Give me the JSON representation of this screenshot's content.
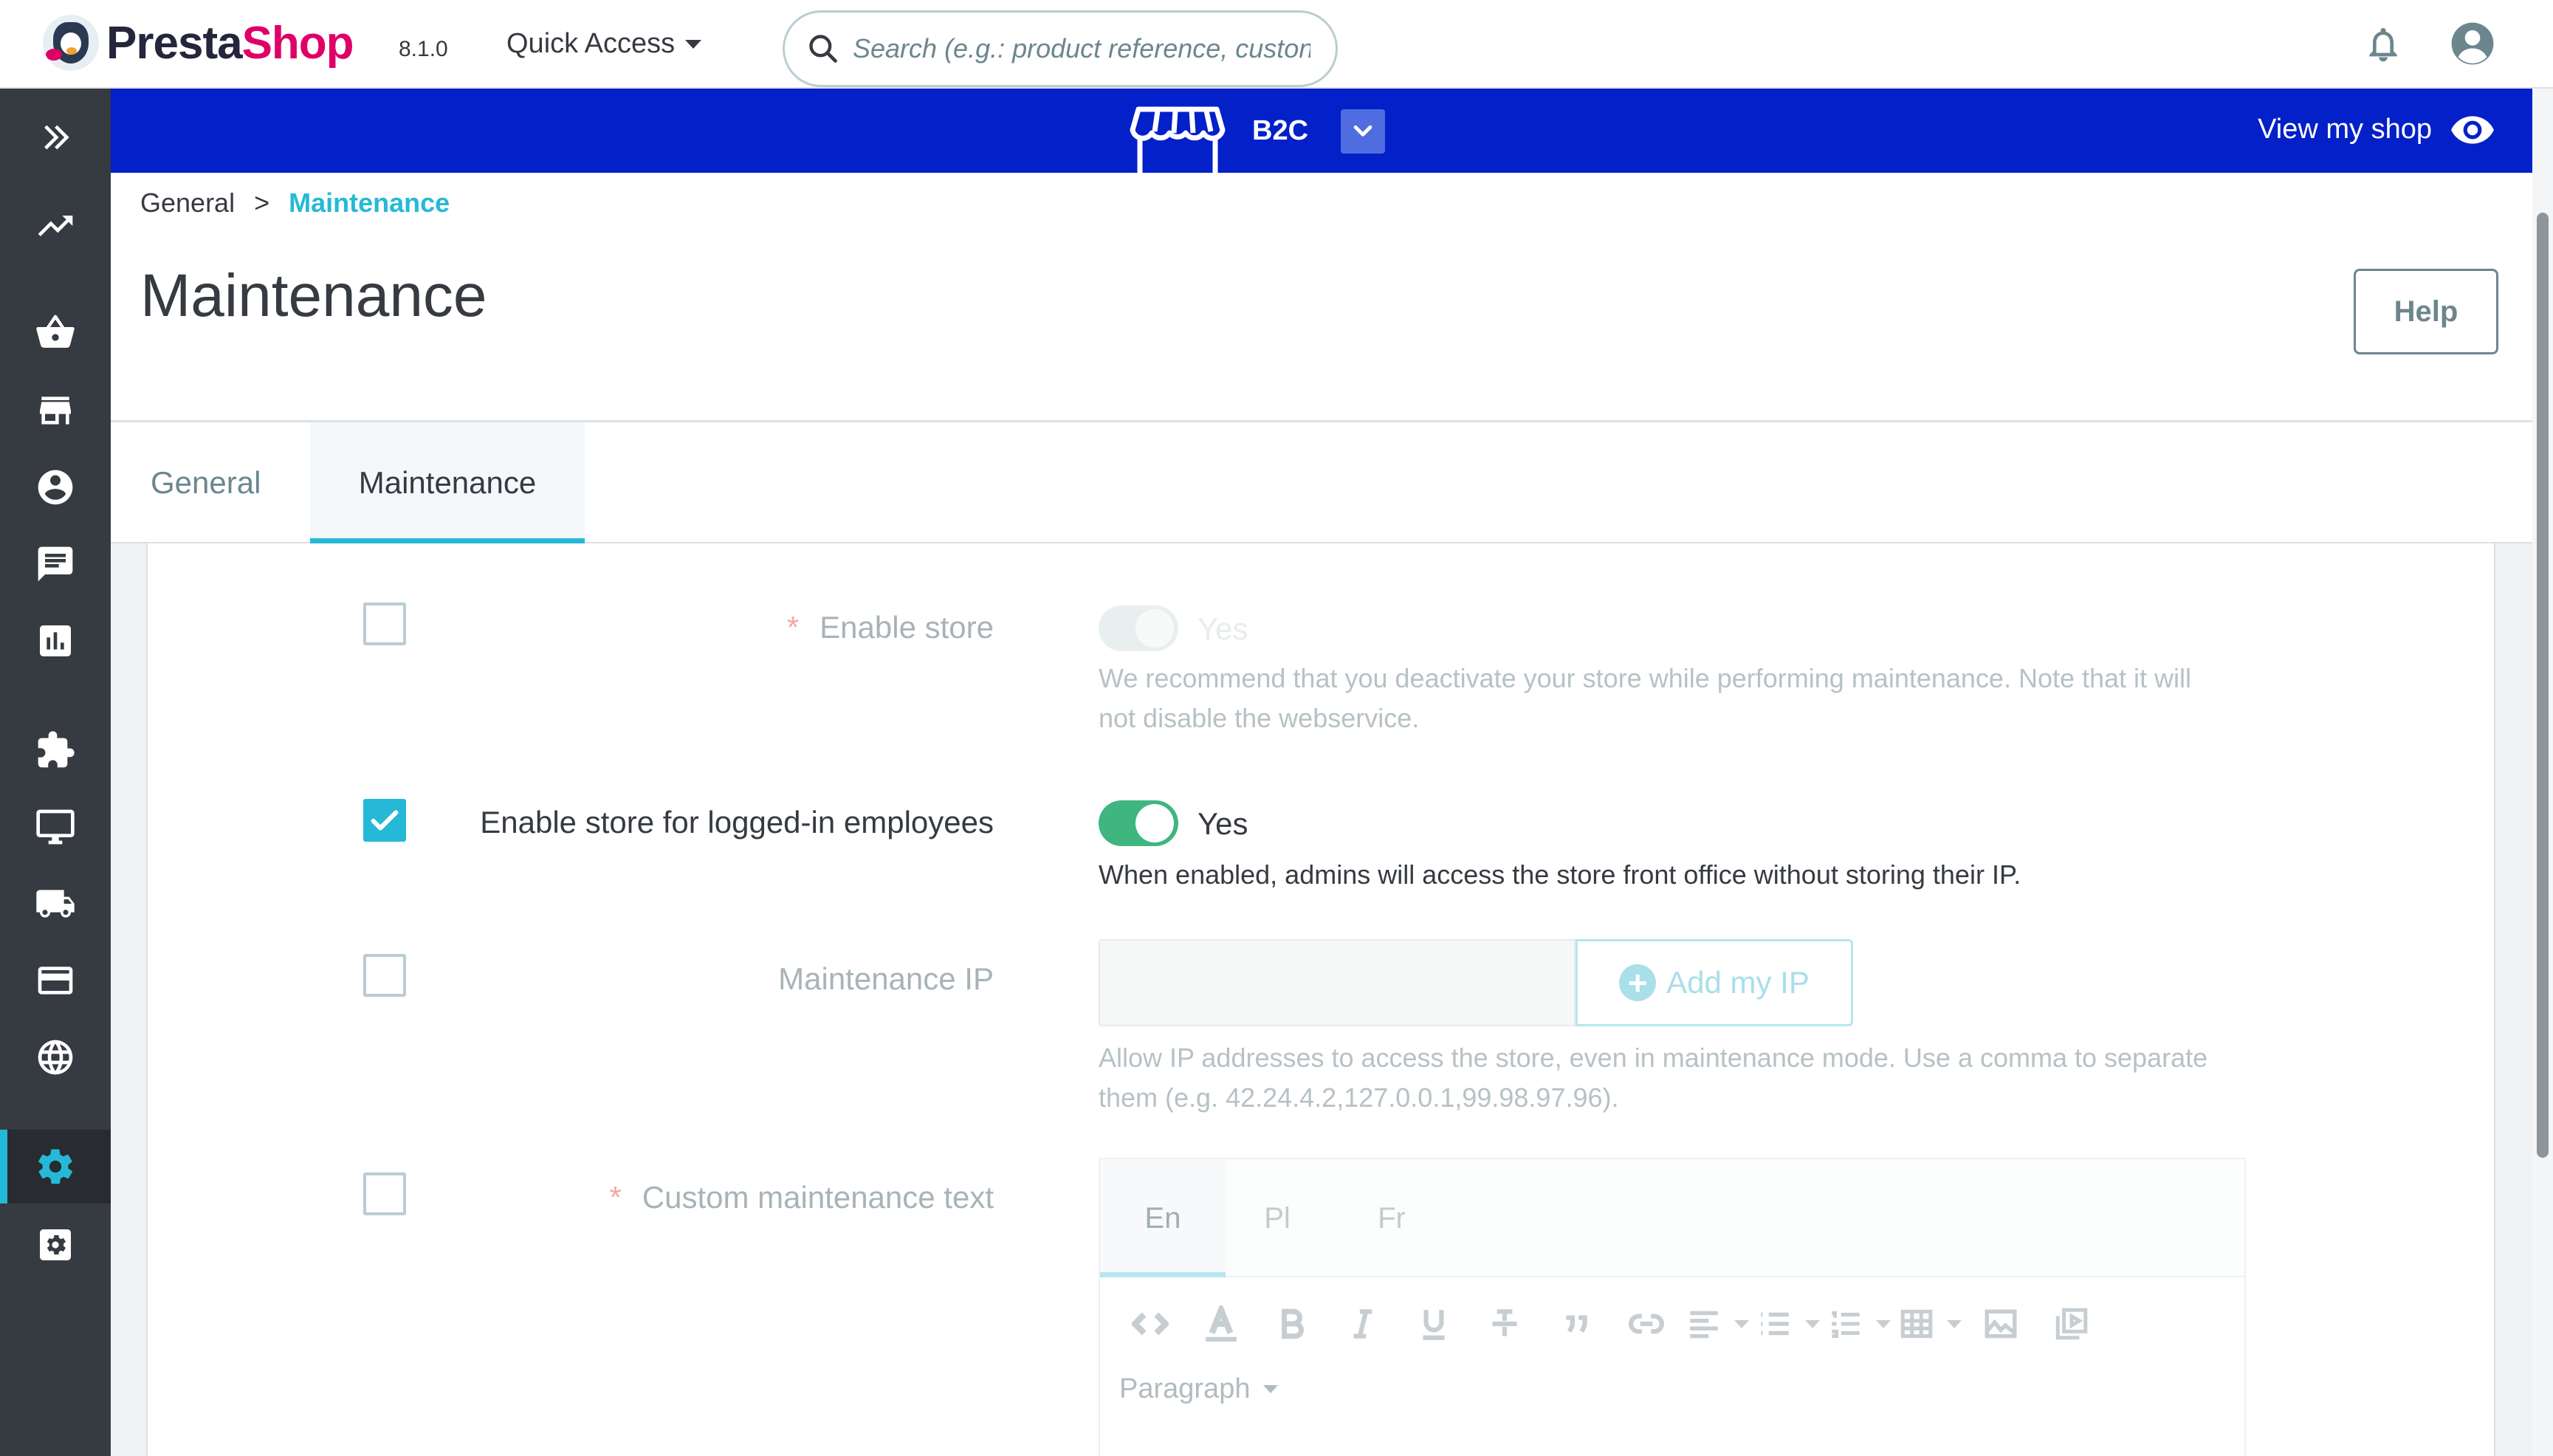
{
  "header": {
    "brand_dark": "Presta",
    "brand_pink": "Shop",
    "version": "8.1.0",
    "quick_access": "Quick Access",
    "search_placeholder": "Search (e.g.: product reference, custon",
    "icons": {
      "notifications": "bell-icon",
      "account": "account-icon",
      "search": "search-icon"
    }
  },
  "sidebar": {
    "items": [
      {
        "name": "expand",
        "icon": "double-chevron-right-icon"
      },
      {
        "name": "dashboard",
        "icon": "trending-up-icon"
      },
      {
        "name": "orders",
        "icon": "basket-icon"
      },
      {
        "name": "catalog",
        "icon": "store-icon"
      },
      {
        "name": "customers",
        "icon": "account-circle-icon"
      },
      {
        "name": "customer-service",
        "icon": "chat-icon"
      },
      {
        "name": "stats",
        "icon": "bar-chart-icon"
      },
      {
        "name": "modules",
        "icon": "puzzle-icon"
      },
      {
        "name": "design",
        "icon": "desktop-icon"
      },
      {
        "name": "shipping",
        "icon": "truck-icon"
      },
      {
        "name": "payment",
        "icon": "credit-card-icon"
      },
      {
        "name": "international",
        "icon": "globe-icon"
      },
      {
        "name": "shop-parameters",
        "icon": "gear-icon",
        "active": true
      },
      {
        "name": "advanced-parameters",
        "icon": "settings-box-icon"
      }
    ],
    "active_color": "#25b9d7"
  },
  "shopbar": {
    "shop_name": "B2C",
    "view_shop": "View my shop",
    "color": "#0420c8"
  },
  "page": {
    "breadcrumb_root": "General",
    "breadcrumb_sep": ">",
    "breadcrumb_current": "Maintenance",
    "title": "Maintenance",
    "help": "Help"
  },
  "tabs": [
    {
      "label": "General",
      "active": false
    },
    {
      "label": "Maintenance",
      "active": true
    }
  ],
  "form": {
    "enable_store": {
      "label": "Enable store",
      "required_mark": "*",
      "checked": false,
      "switch_value": "Yes",
      "hint": "We recommend that you deactivate your store while performing maintenance. Note that it will not disable the webservice."
    },
    "enable_logged_in": {
      "label": "Enable store for logged-in employees",
      "checked": true,
      "switch_value": "Yes",
      "hint": "When enabled, admins will access the store front office without storing their IP."
    },
    "maintenance_ip": {
      "label": "Maintenance IP",
      "checked": false,
      "value": "",
      "add_button": "Add my IP",
      "hint": "Allow IP addresses to access the store, even in maintenance mode. Use a comma to separate them (e.g. 42.24.4.2,127.0.0.1,99.98.97.96)."
    },
    "custom_text": {
      "label": "Custom maintenance text",
      "required_mark": "*",
      "checked": false,
      "languages": [
        "En",
        "Pl",
        "Fr"
      ],
      "paragraph": "Paragraph",
      "toolbar": [
        "code-icon",
        "text-color-icon",
        "bold-icon",
        "italic-icon",
        "underline-icon",
        "strikethrough-icon",
        "quote-icon",
        "link-icon",
        "align-icon",
        "bullet-list-icon",
        "numbered-list-icon",
        "table-icon",
        "image-icon",
        "media-icon"
      ]
    }
  },
  "colors": {
    "accent": "#25b9d7",
    "toggle_on": "#3fb67f",
    "text": "#363a41"
  }
}
